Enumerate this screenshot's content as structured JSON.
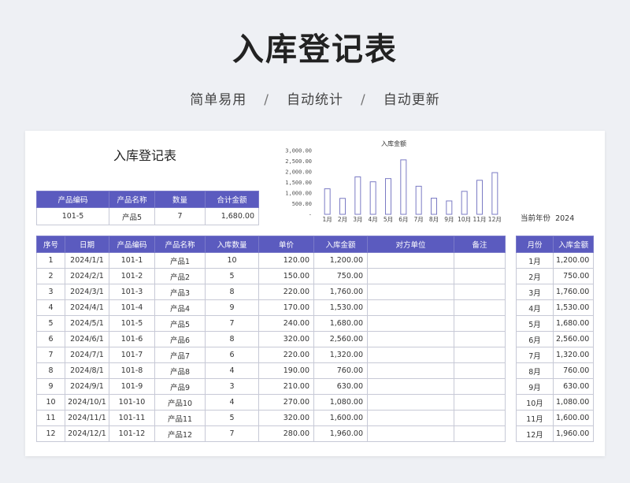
{
  "page": {
    "hero_title": "入库登记表",
    "subtitle_parts": [
      "简单易用",
      "/",
      "自动统计",
      "/",
      "自动更新"
    ]
  },
  "sheet": {
    "title": "入库登记表",
    "summary": {
      "headers": [
        "产品编码",
        "产品名称",
        "数量",
        "合计金额"
      ],
      "values": [
        "101-5",
        "产品5",
        "7",
        "1,680.00"
      ]
    },
    "year_label": "当前年份",
    "year_value": "2024",
    "main_headers": [
      "序号",
      "日期",
      "产品编码",
      "产品名称",
      "入库数量",
      "单价",
      "入库金额",
      "对方单位",
      "备注"
    ],
    "rows": [
      [
        "1",
        "2024/1/1",
        "101-1",
        "产品1",
        "10",
        "120.00",
        "1,200.00",
        "",
        ""
      ],
      [
        "2",
        "2024/2/1",
        "101-2",
        "产品2",
        "5",
        "150.00",
        "750.00",
        "",
        ""
      ],
      [
        "3",
        "2024/3/1",
        "101-3",
        "产品3",
        "8",
        "220.00",
        "1,760.00",
        "",
        ""
      ],
      [
        "4",
        "2024/4/1",
        "101-4",
        "产品4",
        "9",
        "170.00",
        "1,530.00",
        "",
        ""
      ],
      [
        "5",
        "2024/5/1",
        "101-5",
        "产品5",
        "7",
        "240.00",
        "1,680.00",
        "",
        ""
      ],
      [
        "6",
        "2024/6/1",
        "101-6",
        "产品6",
        "8",
        "320.00",
        "2,560.00",
        "",
        ""
      ],
      [
        "7",
        "2024/7/1",
        "101-7",
        "产品7",
        "6",
        "220.00",
        "1,320.00",
        "",
        ""
      ],
      [
        "8",
        "2024/8/1",
        "101-8",
        "产品8",
        "4",
        "190.00",
        "760.00",
        "",
        ""
      ],
      [
        "9",
        "2024/9/1",
        "101-9",
        "产品9",
        "3",
        "210.00",
        "630.00",
        "",
        ""
      ],
      [
        "10",
        "2024/10/1",
        "101-10",
        "产品10",
        "4",
        "270.00",
        "1,080.00",
        "",
        ""
      ],
      [
        "11",
        "2024/11/1",
        "101-11",
        "产品11",
        "5",
        "320.00",
        "1,600.00",
        "",
        ""
      ],
      [
        "12",
        "2024/12/1",
        "101-12",
        "产品12",
        "7",
        "280.00",
        "1,960.00",
        "",
        ""
      ]
    ],
    "month_headers": [
      "月份",
      "入库金额"
    ],
    "month_rows": [
      [
        "1月",
        "1,200.00"
      ],
      [
        "2月",
        "750.00"
      ],
      [
        "3月",
        "1,760.00"
      ],
      [
        "4月",
        "1,530.00"
      ],
      [
        "5月",
        "1,680.00"
      ],
      [
        "6月",
        "2,560.00"
      ],
      [
        "7月",
        "1,320.00"
      ],
      [
        "8月",
        "760.00"
      ],
      [
        "9月",
        "630.00"
      ],
      [
        "10月",
        "1,080.00"
      ],
      [
        "11月",
        "1,600.00"
      ],
      [
        "12月",
        "1,960.00"
      ]
    ]
  },
  "chart_data": {
    "type": "bar",
    "title": "入库金额",
    "categories": [
      "1月",
      "2月",
      "3月",
      "4月",
      "5月",
      "6月",
      "7月",
      "8月",
      "9月",
      "10月",
      "11月",
      "12月"
    ],
    "values": [
      1200,
      750,
      1760,
      1530,
      1680,
      2560,
      1320,
      760,
      630,
      1080,
      1600,
      1960
    ],
    "ylim": [
      0,
      3000
    ],
    "yticks": [
      "-",
      "500.00",
      "1,000.00",
      "1,500.00",
      "2,000.00",
      "2,500.00",
      "3,000.00"
    ],
    "grid": false,
    "bar_fill": "#ffffff",
    "bar_stroke": "#7b7bc4"
  },
  "colors": {
    "header_bg": "#5b5bbf",
    "border": "#c7c9d6"
  }
}
